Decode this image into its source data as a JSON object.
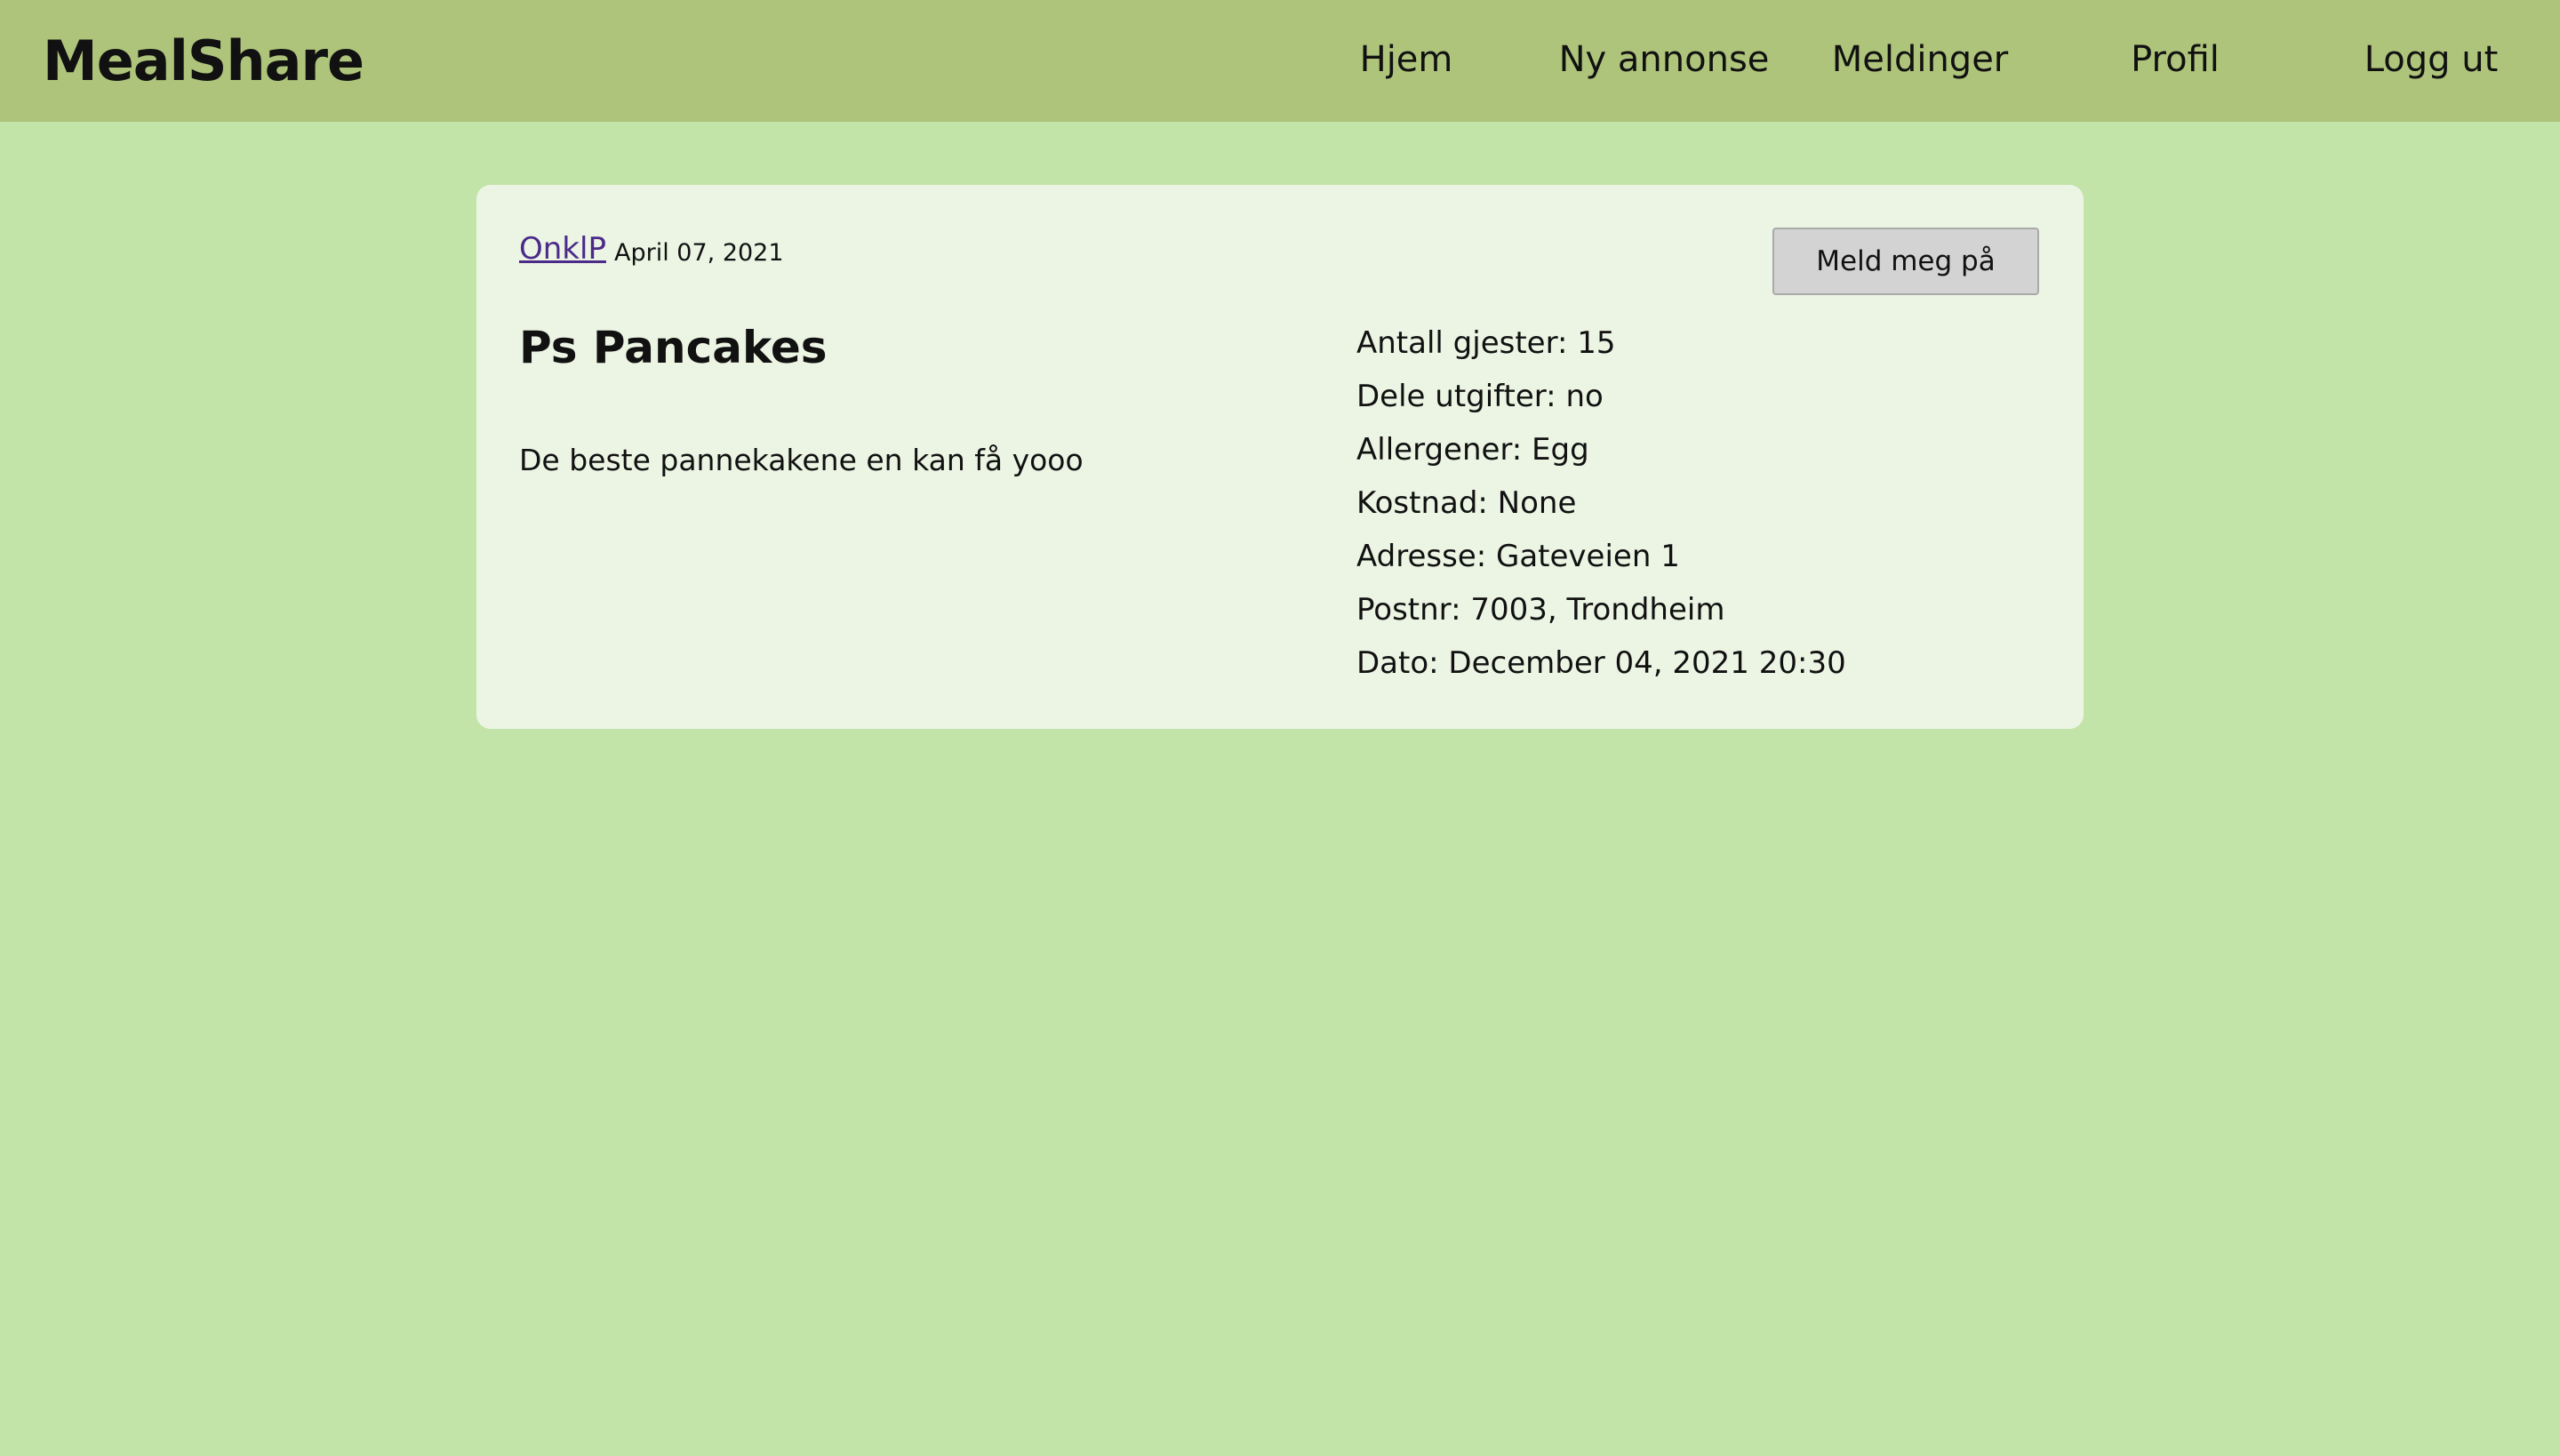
{
  "navbar": {
    "brand": "MealShare",
    "links": [
      "Hjem",
      "Ny annonse",
      "Meldinger",
      "Profil",
      "Logg ut"
    ]
  },
  "post": {
    "author": "OnklP",
    "posted_date": "April 07, 2021",
    "join_button_label": "Meld meg på",
    "title": "Ps Pancakes",
    "description": "De beste pannekakene en kan få yooo",
    "details": [
      "Antall gjester: 15",
      "Dele utgifter: no",
      "Allergener: Egg",
      "Kostnad: None",
      "Adresse: Gateveien 1",
      "Postnr: 7003, Trondheim",
      "Dato: December 04, 2021 20:30"
    ]
  },
  "colors": {
    "page_background": "#c3e4a9",
    "navbar_background": "#aec47b",
    "card_background": "#ecf5e4",
    "link_color": "#4b2a8a",
    "button_background": "#d3d3d3"
  }
}
